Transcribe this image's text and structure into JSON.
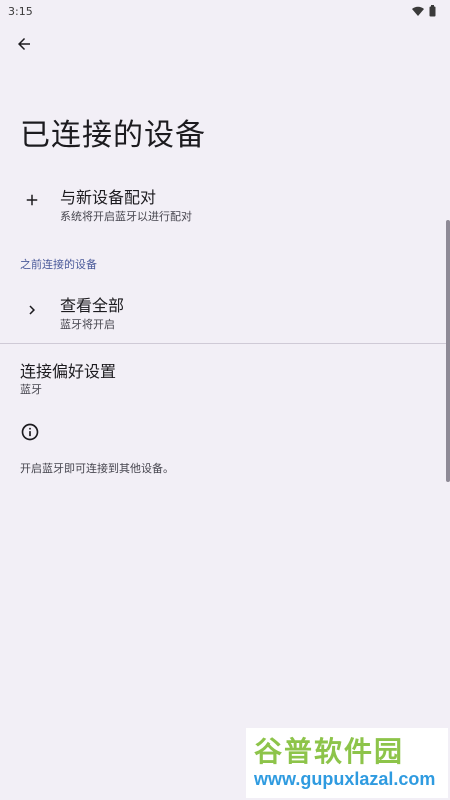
{
  "status_bar": {
    "time": "3:15",
    "wifi_icon": "wifi-icon",
    "battery_icon": "battery-icon"
  },
  "header": {
    "back_icon": "arrow-back-icon"
  },
  "page": {
    "title": "已连接的设备"
  },
  "pair_new": {
    "icon": "plus-icon",
    "title": "与新设备配对",
    "subtitle": "系统将开启蓝牙以进行配对"
  },
  "previous_section": {
    "header": "之前连接的设备"
  },
  "see_all": {
    "icon": "chevron-right-icon",
    "title": "查看全部",
    "subtitle": "蓝牙将开启"
  },
  "preferences": {
    "title": "连接偏好设置",
    "subtitle": "蓝牙"
  },
  "footer": {
    "icon": "info-icon",
    "text": "开启蓝牙即可连接到其他设备。"
  },
  "watermark": {
    "brand": "谷普软件园",
    "url": "www.gupuxlazal.com"
  },
  "colors": {
    "background": "#f2eff6",
    "accent": "#4a5a9a"
  }
}
